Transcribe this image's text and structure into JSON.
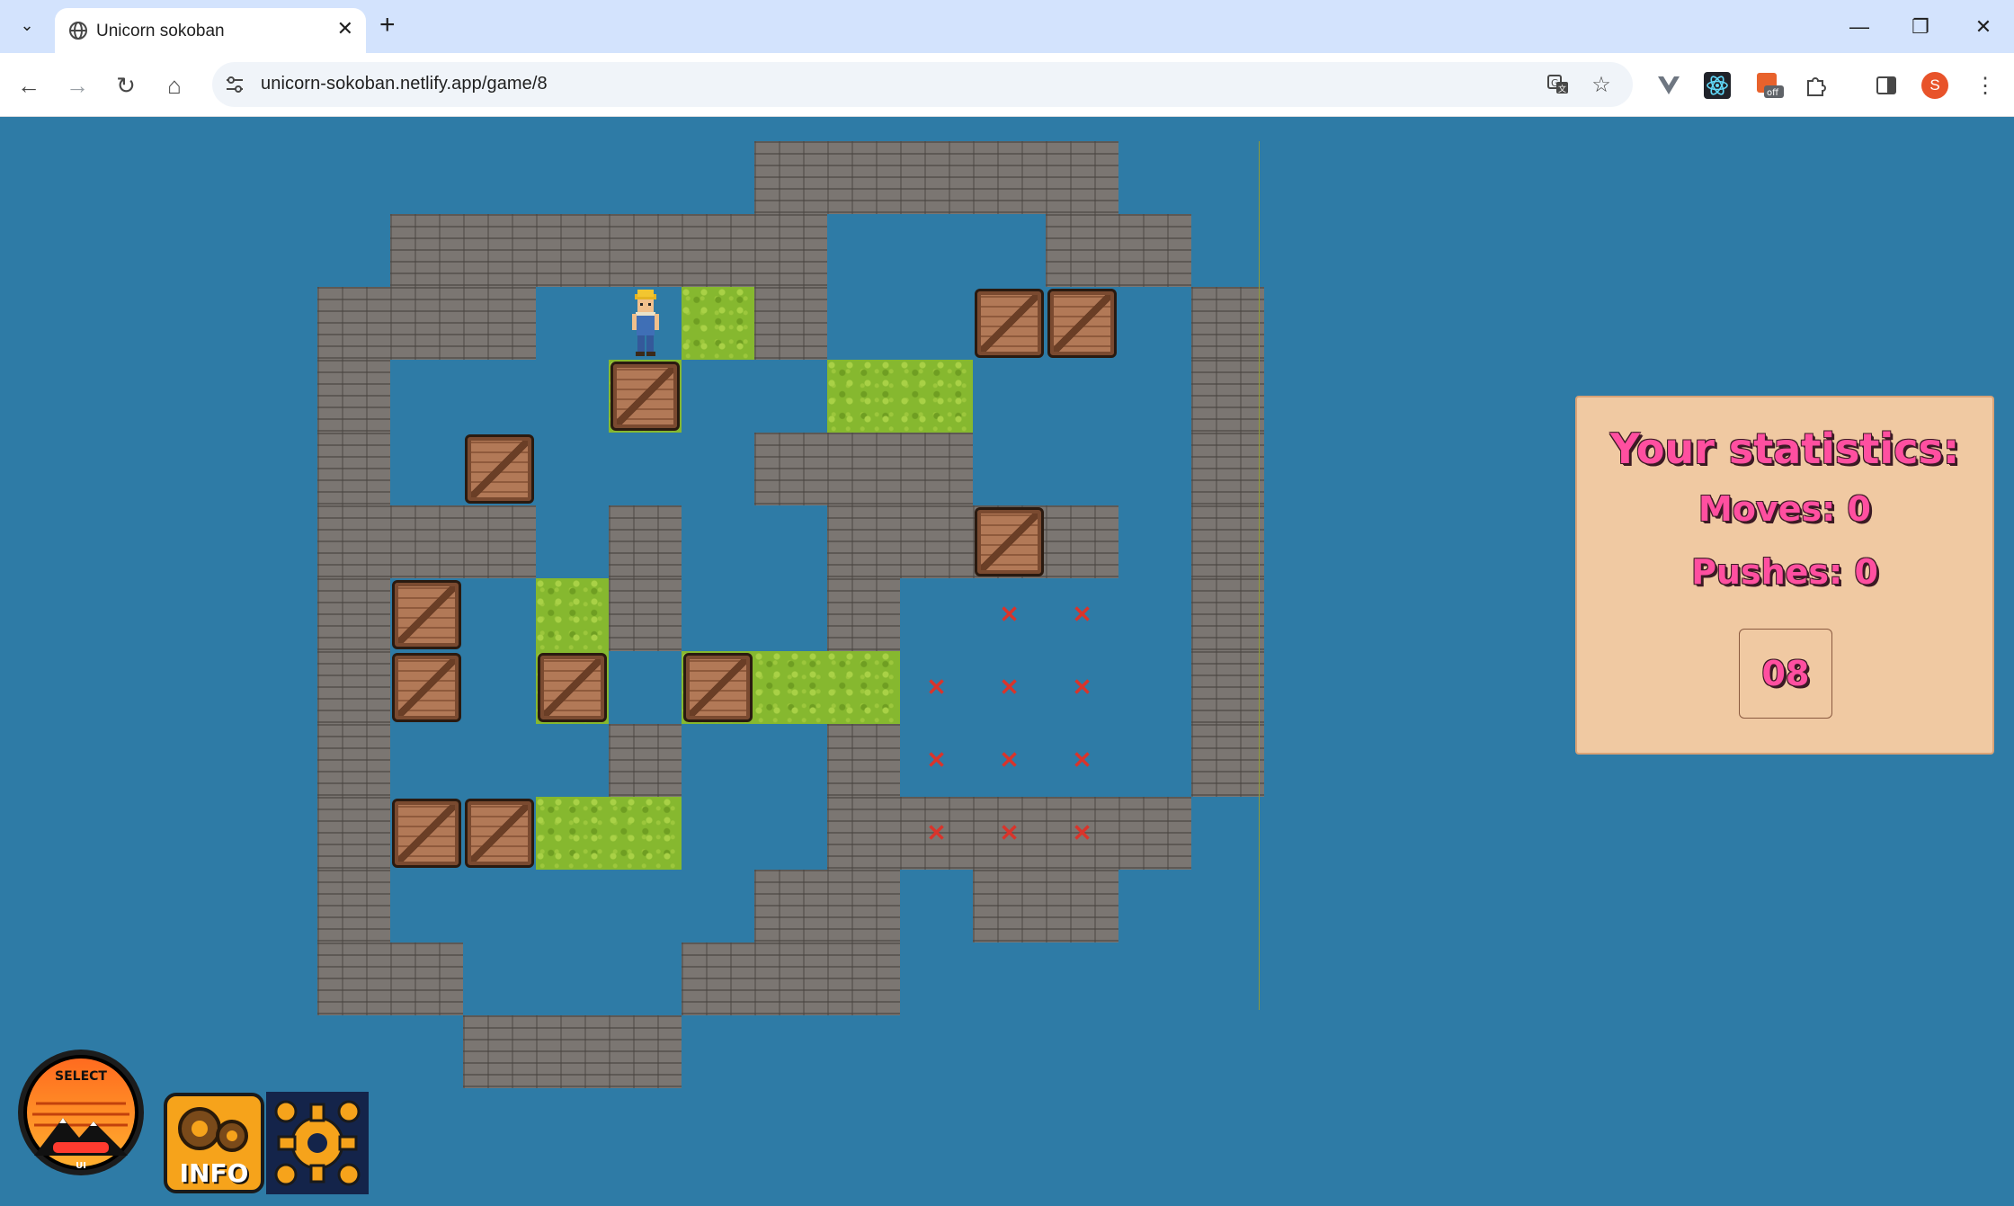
{
  "browser": {
    "tab_title": "Unicorn sokoban",
    "url": "unicorn-sokoban.netlify.app/game/8",
    "profile_initial": "S"
  },
  "game": {
    "colors": {
      "background": "#2e7ba6",
      "floor": "#86b82f",
      "wall": "#7b7672",
      "crate": "#a56c4a",
      "goal": "#d9342b"
    },
    "map": [
      "      #####  ",
      " ######   ## ",
      "###  .#     #",
      "#   .  ..   #",
      "#     ###   #",
      "### #  #### #",
      "#  .#  #    #",
      "#  . ...    #",
      "#   #  #    #",
      "#  ..  #####",
      "#     ## ##",
      "##   ###  ",
      "  ###"
    ],
    "crates": [
      [
        9,
        2
      ],
      [
        10,
        2
      ],
      [
        4,
        3
      ],
      [
        2,
        4
      ],
      [
        9,
        5
      ],
      [
        1,
        6
      ],
      [
        1,
        7
      ],
      [
        3,
        7
      ],
      [
        5,
        7
      ],
      [
        1,
        9
      ],
      [
        2,
        9
      ]
    ],
    "goals": [
      [
        9,
        6
      ],
      [
        10,
        6
      ],
      [
        8,
        7
      ],
      [
        9,
        7
      ],
      [
        10,
        7
      ],
      [
        8,
        8
      ],
      [
        9,
        8
      ],
      [
        10,
        8
      ],
      [
        8,
        9
      ],
      [
        9,
        9
      ],
      [
        10,
        9
      ]
    ],
    "player": [
      4,
      2
    ]
  },
  "stats": {
    "title": "Your statistics:",
    "moves_line": "Moves: 0",
    "pushes_line": "Pushes: 0",
    "level": "08"
  },
  "buttons": {
    "select_label": "SELECT",
    "select_sub": "UI",
    "info_label": "INFO"
  }
}
